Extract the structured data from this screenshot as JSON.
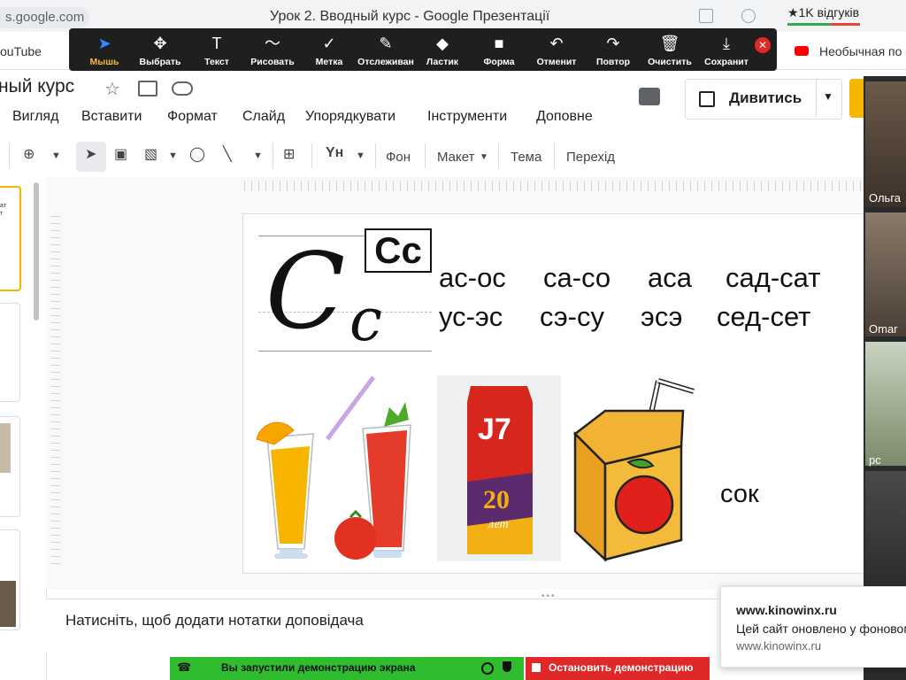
{
  "browser": {
    "url_fragment": "s.google.com",
    "window_title": "Урок 2. Вводный курс - Google Презентації",
    "feedback_badge": "★1K відгуків",
    "bookmark_left": "ouTube",
    "bookmark_right": "Необычная по"
  },
  "annotate_toolbar": {
    "tools": [
      {
        "label": "Мышь",
        "icon": "cursor-icon",
        "glyph": "➤",
        "active": true
      },
      {
        "label": "Выбрать",
        "icon": "move-icon",
        "glyph": "✥"
      },
      {
        "label": "Текст",
        "icon": "text-icon",
        "glyph": "T"
      },
      {
        "label": "Рисовать",
        "icon": "draw-icon",
        "glyph": "〜"
      },
      {
        "label": "Метка",
        "icon": "check-icon",
        "glyph": "✓"
      },
      {
        "label": "Отслеживан",
        "icon": "spotlight-icon",
        "glyph": "✎"
      },
      {
        "label": "Ластик",
        "icon": "eraser-icon",
        "glyph": "◆"
      },
      {
        "label": "Форма",
        "icon": "shape-icon",
        "glyph": "■"
      },
      {
        "label": "Отменит",
        "icon": "undo-icon",
        "glyph": "↶"
      },
      {
        "label": "Повтор",
        "icon": "redo-icon",
        "glyph": "↷"
      },
      {
        "label": "Очистить",
        "icon": "trash-icon",
        "glyph": "🗑"
      },
      {
        "label": "Сохранит",
        "icon": "save-icon",
        "glyph": "⤓"
      }
    ],
    "close_glyph": "✕"
  },
  "doc": {
    "title": "ный курс",
    "menu": [
      "Вигляд",
      "Вставити",
      "Формат",
      "Слайд",
      "Упорядкувати",
      "Інструменти",
      "Доповне"
    ],
    "present_label": "Дивитись"
  },
  "toolbar": {
    "background_label": "Фон",
    "layout_label": "Макет",
    "theme_label": "Тема",
    "transition_label": "Перехід"
  },
  "filmstrip": {
    "thumb1_text": "ат\nт"
  },
  "slide": {
    "handwriting_upper": "C",
    "handwriting_lower": "c",
    "print_letters": "Cc",
    "syllables_row1": [
      "ас-ос",
      "са-со",
      "аса",
      "сад-сат"
    ],
    "syllables_row2": [
      "ус-эс",
      "сэ-су",
      "эсэ",
      "сед-сет"
    ],
    "word": "сок",
    "juice_box_brand": "J7",
    "juice_box_number": "20",
    "juice_box_sub": "лет"
  },
  "notes": {
    "placeholder": "Натисніть, щоб додати нотатки доповідача"
  },
  "video_panel": {
    "participants": [
      "Ольга",
      "Omar",
      "рс"
    ]
  },
  "notification": {
    "title": "www.kinowinx.ru",
    "body": "Цей сайт оновлено у фоновому",
    "site": "www.kinowinx.ru"
  },
  "share": {
    "status_text": "Вы запустили демонстрацию экрана",
    "stop_label": "Остановить демонстрацию"
  },
  "colors": {
    "annot_bg": "#1f1f1f",
    "active_label": "#f6b73c",
    "share_green": "#2fbd2f",
    "stop_red": "#e02828",
    "present_accent": "#f6b600"
  }
}
